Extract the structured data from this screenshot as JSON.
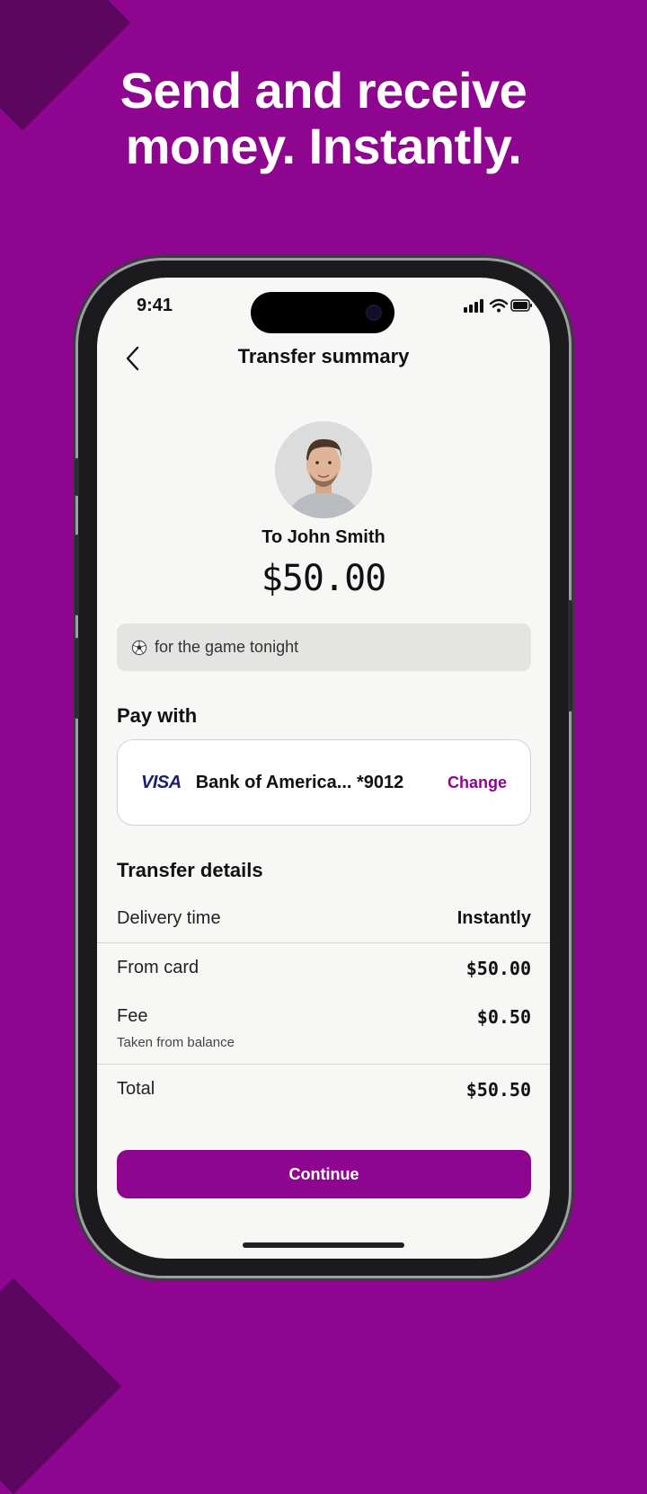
{
  "promo": {
    "headline_line1": "Send and receive",
    "headline_line2": "money. Instantly."
  },
  "status_bar": {
    "time": "9:41"
  },
  "nav": {
    "title": "Transfer summary"
  },
  "recipient": {
    "label": "To John Smith",
    "amount": "$50.00"
  },
  "note": {
    "text": "for the game tonight",
    "icon": "soccer-ball-icon"
  },
  "pay_with": {
    "title": "Pay with",
    "card_brand": "VISA",
    "card_label": "Bank of America... *9012",
    "change_label": "Change"
  },
  "transfer_details": {
    "title": "Transfer details",
    "delivery_label": "Delivery time",
    "delivery_value": "Instantly",
    "from_card_label": "From card",
    "from_card_value": "$50.00",
    "fee_label": "Fee",
    "fee_value": "$0.50",
    "fee_note": "Taken from balance",
    "total_label": "Total",
    "total_value": "$50.50"
  },
  "actions": {
    "continue_label": "Continue"
  },
  "colors": {
    "brand": "#8e0690",
    "background": "#f7f7f5",
    "visa": "#1a1f71"
  }
}
